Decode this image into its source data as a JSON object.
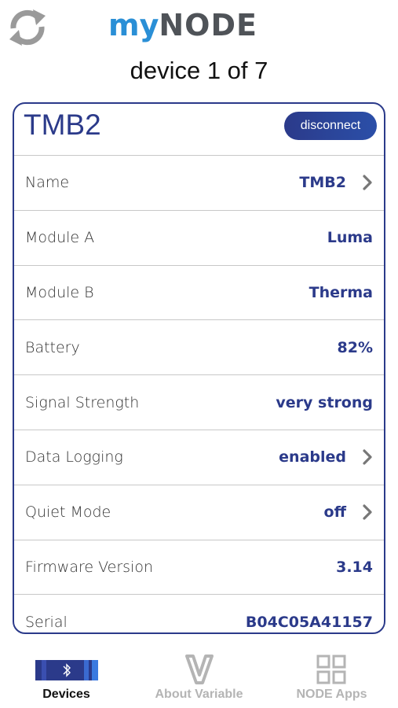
{
  "header": {
    "logo_my": "my",
    "logo_node": "NODE",
    "device_count": "device 1 of 7"
  },
  "device": {
    "title": "TMB2",
    "disconnect_label": "disconnect",
    "rows": [
      {
        "label": "Name",
        "value": "TMB2",
        "chevron": true
      },
      {
        "label": "Module A",
        "value": "Luma",
        "chevron": false
      },
      {
        "label": "Module B",
        "value": "Therma",
        "chevron": false
      },
      {
        "label": "Battery",
        "value": "82%",
        "chevron": false
      },
      {
        "label": "Signal Strength",
        "value": "very strong",
        "chevron": false
      },
      {
        "label": "Data Logging",
        "value": "enabled",
        "chevron": true
      },
      {
        "label": "Quiet Mode",
        "value": "off",
        "chevron": true
      },
      {
        "label": "Firmware Version",
        "value": "3.14",
        "chevron": false
      },
      {
        "label": "Serial",
        "value": "B04C05A41157",
        "chevron": false
      }
    ]
  },
  "tabs": [
    {
      "label": "Devices",
      "icon": "bluetooth-icon",
      "active": true
    },
    {
      "label": "About Variable",
      "icon": "variable-logo-icon",
      "active": false
    },
    {
      "label": "NODE Apps",
      "icon": "grid-icon",
      "active": false
    }
  ],
  "colors": {
    "accent": "#2b3a8a",
    "logo_blue": "#2a8fd6",
    "logo_gray": "#4f5358",
    "inactive": "#b4b4b4"
  }
}
